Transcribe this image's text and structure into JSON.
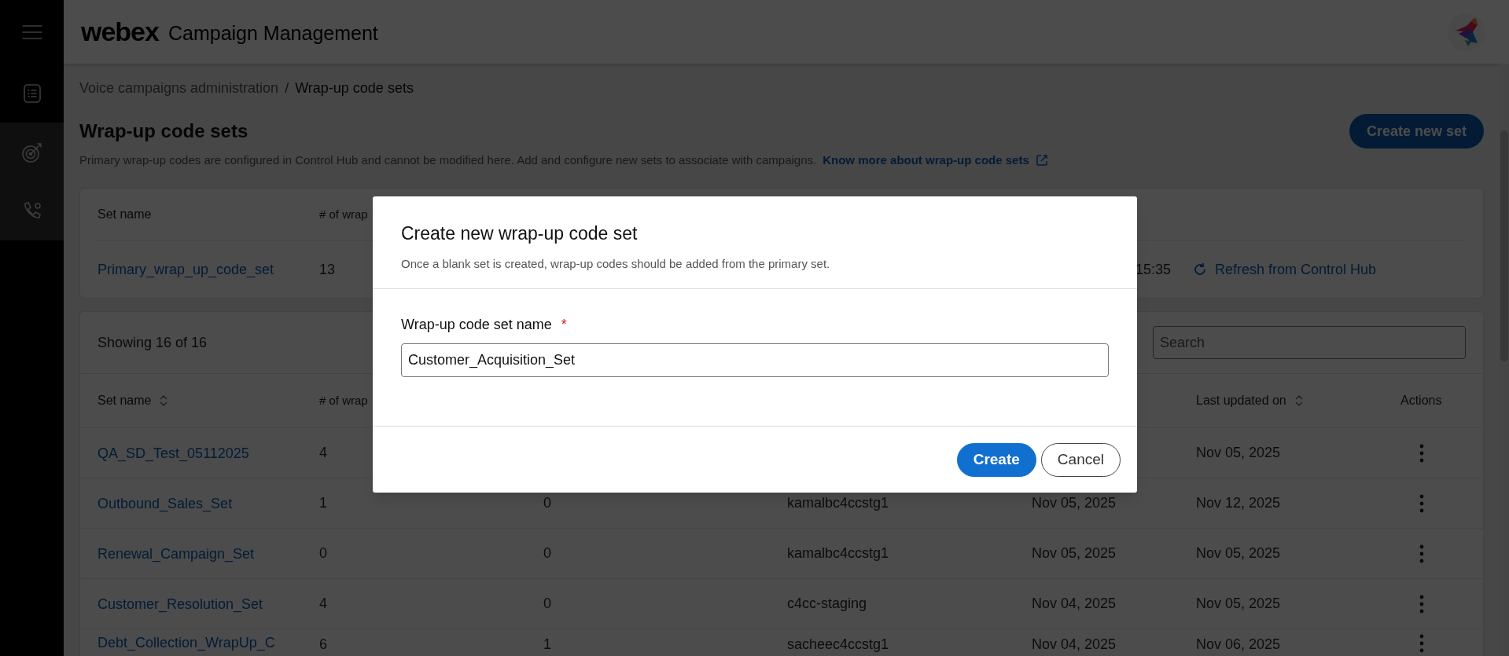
{
  "sidebar": {
    "items": [
      {
        "kind": "menu",
        "selected": false
      },
      {
        "kind": "list",
        "selected": false
      },
      {
        "kind": "target",
        "selected": true
      },
      {
        "kind": "phone",
        "selected": true
      }
    ]
  },
  "header": {
    "brand": "webex",
    "product": "Campaign Management"
  },
  "breadcrumb": {
    "separator": "/",
    "items": [
      {
        "label": "Voice campaigns administration",
        "current": false
      },
      {
        "label": "Wrap-up code sets",
        "current": true
      }
    ]
  },
  "page": {
    "title": "Wrap-up code sets",
    "description": "Primary wrap-up codes are configured in Control Hub and cannot be modified here. Add and configure new sets to associate with campaigns.",
    "link": "Know more about wrap-up code sets",
    "create_button": "Create new set"
  },
  "primary_table": {
    "columns": {
      "set_name": "Set name",
      "column_2": "# of wrap"
    },
    "row": {
      "set_name": "Primary_wrap_up_code_set",
      "column_2": "13",
      "column_3": "15:35"
    },
    "refresh_link": "Refresh from Control Hub"
  },
  "sets_table": {
    "summary": "Showing 16 of 16",
    "search": {
      "placeholder": "Search"
    },
    "columns": {
      "set_name": {
        "label": "Set name",
        "sortable": true
      },
      "column_2": {
        "label": "# of wrap",
        "sortable": false
      },
      "last_updated": {
        "label": "Last updated on",
        "sortable": true
      },
      "actions": {
        "label": "Actions",
        "sortable": false
      }
    },
    "rows": [
      {
        "set_name": "QA_SD_Test_05112025",
        "column_2": "4",
        "last_updated": "Nov 05, 2025"
      },
      {
        "set_name": "Outbound_Sales_Set",
        "column_2": "1",
        "column_3": "0",
        "column_4": "kamalbc4ccstg1",
        "column_5": "Nov 05, 2025",
        "last_updated": "Nov 12, 2025"
      },
      {
        "set_name": "Renewal_Campaign_Set",
        "column_2": "0",
        "column_3": "0",
        "column_4": "kamalbc4ccstg1",
        "column_5": "Nov 05, 2025",
        "last_updated": "Nov 05, 2025"
      },
      {
        "set_name": "Customer_Resolution_Set",
        "column_2": "4",
        "column_3": "0",
        "column_4": "c4cc-staging",
        "column_5": "Nov 04, 2025",
        "last_updated": "Nov 05, 2025"
      },
      {
        "set_name": "Debt_Collection_WrapUp_C",
        "column_2": "6",
        "column_3": "1",
        "column_4": "sacheec4ccstg1",
        "column_5": "Nov 04, 2025",
        "last_updated": "Nov 06, 2025"
      }
    ]
  },
  "modal": {
    "title": "Create new wrap-up code set",
    "subtitle": "Once a blank set is created, wrap-up codes should be added from the primary set.",
    "field_label": "Wrap-up code set name",
    "required_mark": "*",
    "field_value": "Customer_Acquisition_Set",
    "buttons": [
      {
        "label": "Create",
        "kind": "primary"
      },
      {
        "label": "Cancel",
        "kind": "secondary"
      }
    ]
  }
}
